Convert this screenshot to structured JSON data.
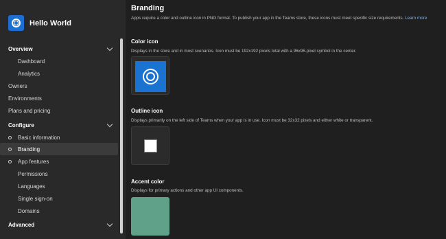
{
  "app": {
    "name": "Hello World"
  },
  "sidebar": {
    "overview": {
      "label": "Overview",
      "items": [
        "Dashboard",
        "Analytics"
      ]
    },
    "top_items": [
      "Owners",
      "Environments",
      "Plans and pricing"
    ],
    "configure": {
      "label": "Configure",
      "items": [
        "Basic information",
        "Branding",
        "App features"
      ]
    },
    "configure_sub": [
      "Permissions",
      "Languages",
      "Single sign-on",
      "Domains"
    ],
    "advanced": {
      "label": "Advanced"
    },
    "active_item": "Branding"
  },
  "main": {
    "title": "Branding",
    "description": "Apps require a color and outline icon in PNG format. To publish your app in the Teams store, these icons must meet specific size requirements.",
    "learn_more": "Learn more",
    "color_icon": {
      "title": "Color icon",
      "description": "Displays in the store and in most scenarios. Icon must be 192x192 pixels total with a 96x96-pixel symbol in the center."
    },
    "outline_icon": {
      "title": "Outline icon",
      "description": "Displays primarily on the left side of Teams when your app is in use. Icon must be 32x32 pixels and either white or transparent."
    },
    "accent_color": {
      "title": "Accent color",
      "description": "Displays for primary actions and other app UI components.",
      "value": "#60a18a"
    }
  },
  "colors": {
    "brand_icon": "#1a72d1",
    "accent": "#60a18a"
  }
}
